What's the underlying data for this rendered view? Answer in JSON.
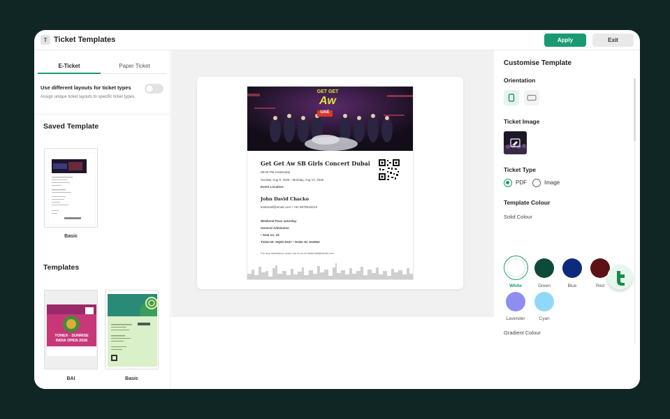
{
  "app": {
    "title": "Ticket Templates",
    "icon_letter": "T"
  },
  "toolbar": {
    "apply_label": "Apply",
    "exit_label": "Exit"
  },
  "tabs": [
    {
      "label": "E-Ticket",
      "active": true
    },
    {
      "label": "Paper Ticket",
      "active": false
    }
  ],
  "layout_option": {
    "title": "Use different layouts for ticket types",
    "description": "Assign unique ticket layouts to specific ticket types.",
    "enabled": false
  },
  "saved": {
    "title": "Saved Template",
    "items": [
      {
        "label": "Basic"
      }
    ]
  },
  "templates": {
    "title": "Templates",
    "items": [
      {
        "label": "BAI"
      },
      {
        "label": "Basic"
      }
    ]
  },
  "thumb_bai": {
    "line1": "YONEX - SUNRISE",
    "line2": "INDIA OPEN 2026"
  },
  "ticket": {
    "banner_text_1": "GET GET",
    "banner_text_2": "Aw",
    "banner_badge": "UAE",
    "event_name": "Get Get Aw SB Girls Concert Dubai",
    "time_location": "08:00 PM Asia/Dubai",
    "dates": "Sunday, Aug 9, 2026  -  Monday, Aug 10, 2026",
    "event_location_label": "Event Location:",
    "attendee_name": "John David Chacko",
    "contact": "testemail@email.com  •  +91 9876543210",
    "pass_name": "Weekend Pass saturday",
    "admission": "General Admission",
    "seat": "•  Seat no: 32",
    "ids": "Ticket ID: HQ91-0347  •  Order ID: 510063",
    "footer_note": "For any assistance reach out to us at testemail@email.com"
  },
  "customise": {
    "title": "Customise Template",
    "orientation_label": "Orientation",
    "orientation": "portrait",
    "ticket_image_label": "Ticket Image",
    "ticket_type_label": "Ticket Type",
    "ticket_types": [
      {
        "label": "PDF",
        "selected": true
      },
      {
        "label": "Image",
        "selected": false
      }
    ],
    "template_colour_label": "Template Colour",
    "solid_colour_label": "Solid Colour",
    "gradient_colour_label": "Gradient Colour",
    "colours": [
      {
        "name": "White",
        "hex": "#ffffff",
        "selected": true
      },
      {
        "name": "Green",
        "hex": "#0e4a39",
        "selected": false
      },
      {
        "name": "Blue",
        "hex": "#0d2b7a",
        "selected": false
      },
      {
        "name": "Red",
        "hex": "#5c1114",
        "selected": false
      },
      {
        "name": "Lavender",
        "hex": "#8f8ef0",
        "selected": false
      },
      {
        "name": "Cyan",
        "hex": "#8fd8f7",
        "selected": false
      }
    ]
  },
  "colors": {
    "accent": "#1a9a71",
    "background": "#0f2624"
  }
}
